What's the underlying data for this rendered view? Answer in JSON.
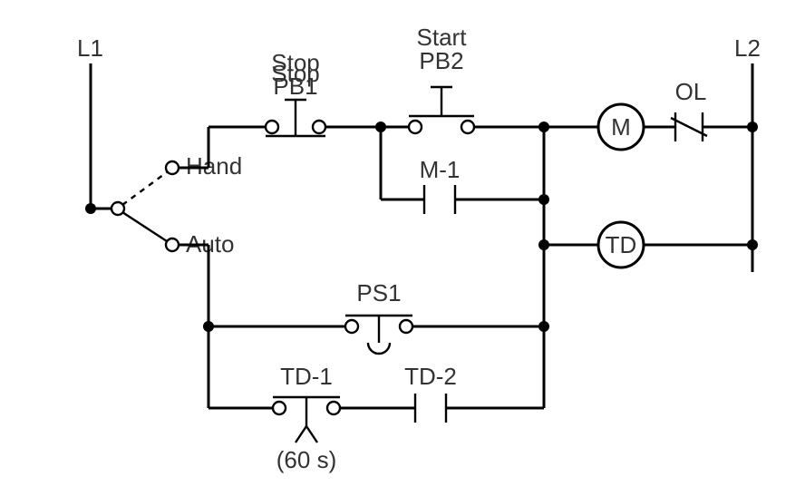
{
  "rails": {
    "L1": "L1",
    "L2": "L2"
  },
  "selector": {
    "hand": "Hand",
    "auto": "Auto"
  },
  "pushbuttons": {
    "stop": {
      "label_top": "Stop",
      "label_bot": "PB1"
    },
    "start": {
      "label_top": "Start",
      "label_bot": "PB2"
    }
  },
  "contacts": {
    "m1": "M-1",
    "td1": "TD-1",
    "td2": "TD-2"
  },
  "pressure_switch": {
    "label": "PS1"
  },
  "coils": {
    "motor": "M",
    "timer": "TD"
  },
  "overload": "OL",
  "timer": {
    "delay": "(60 s)"
  }
}
